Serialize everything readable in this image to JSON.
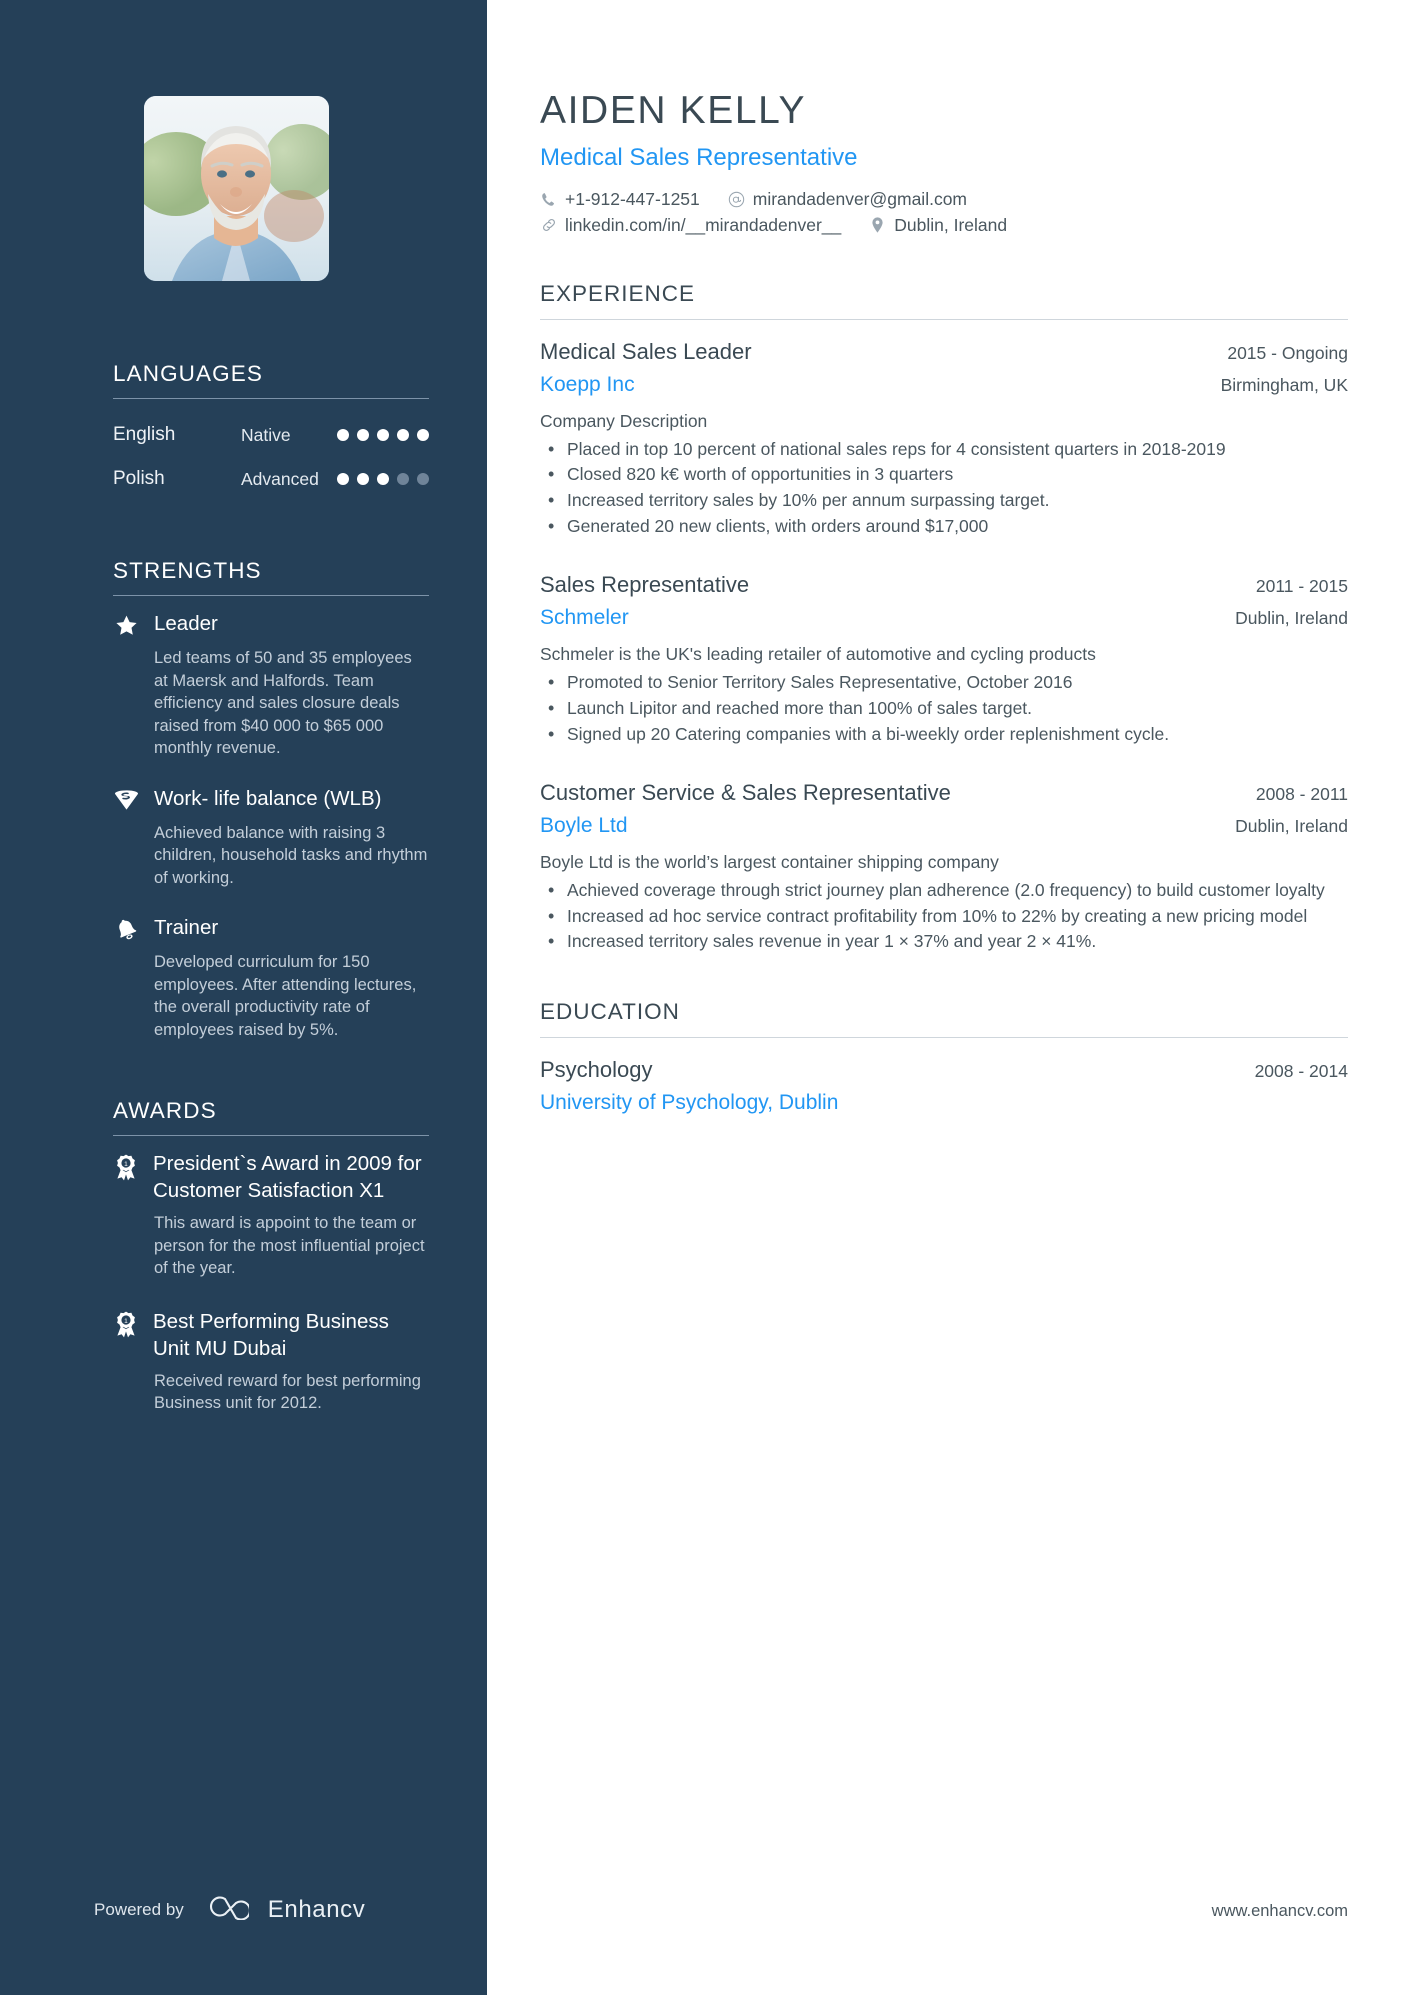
{
  "theme": {
    "sidebar_bg": "#254058",
    "accent": "#2196f3",
    "text_dark": "#3a4953",
    "text_body": "#4a575f"
  },
  "header": {
    "name": "AIDEN KELLY",
    "job_title": "Medical Sales Representative",
    "contacts": [
      {
        "icon": "phone-icon",
        "text": "+1-912-447-1251"
      },
      {
        "icon": "email-icon",
        "text": "mirandadenver@gmail.com"
      },
      {
        "icon": "link-icon",
        "text": "linkedin.com/in/__mirandadenver__"
      },
      {
        "icon": "location-pin-icon",
        "text": "Dublin, Ireland"
      }
    ]
  },
  "sidebar": {
    "photo_alt": "profile-photo",
    "languages": {
      "title": "LANGUAGES",
      "items": [
        {
          "name": "English",
          "level": "Native",
          "filled": 5,
          "total": 5
        },
        {
          "name": "Polish",
          "level": "Advanced",
          "filled": 3,
          "total": 5
        }
      ]
    },
    "strengths": {
      "title": "STRENGTHS",
      "items": [
        {
          "icon": "star-icon",
          "title": "Leader",
          "description": "Led teams of 50 and 35 employees at Maersk and Halfords. Team efficiency and sales closure deals raised from $40 000 to $65 000 monthly revenue."
        },
        {
          "icon": "shield-icon",
          "title": "Work- life balance (WLB)",
          "description": "Achieved balance with raising 3 children, household tasks and rhythm of working."
        },
        {
          "icon": "bell-icon",
          "title": "Trainer",
          "description": "Developed curriculum for 150 employees. After attending lectures, the overall productivity rate of employees raised by 5%."
        }
      ]
    },
    "awards": {
      "title": "AWARDS",
      "items": [
        {
          "icon": "medal-icon",
          "title": "President`s Award in 2009 for Customer Satisfaction X1",
          "description": "This award is appoint to the team or person for the most influential project of the year."
        },
        {
          "icon": "medal-icon",
          "title": "Best Performing Business Unit MU Dubai",
          "description": "Received reward for best performing Business unit for 2012."
        }
      ]
    },
    "footer": {
      "powered_label": "Powered by",
      "brand": "Enhancv",
      "logo": "enhancv-logo-icon"
    }
  },
  "main": {
    "experience": {
      "title": "EXPERIENCE",
      "entries": [
        {
          "role": "Medical Sales Leader",
          "date": "2015 - Ongoing",
          "company": "Koepp Inc",
          "location": "Birmingham, UK",
          "description": "Company Description",
          "bullets": [
            "Placed in top 10 percent of national sales reps for 4 consistent quarters in 2018-2019",
            "Closed 820 k€ worth of opportunities in 3 quarters",
            "Increased territory sales by 10% per annum surpassing target.",
            "Generated 20 new clients, with orders around $17,000"
          ]
        },
        {
          "role": "Sales Representative",
          "date": "2011 - 2015",
          "company": "Schmeler",
          "location": "Dublin, Ireland",
          "description": "Schmeler is the UK's leading retailer of automotive and cycling products",
          "bullets": [
            "Promoted to Senior Territory Sales Representative, October 2016",
            "Launch Lipitor and reached more than 100% of sales target.",
            "Signed up 20 Catering companies with a bi-weekly order replenishment cycle."
          ]
        },
        {
          "role": "Customer Service & Sales Representative",
          "date": "2008 - 2011",
          "company": "Boyle Ltd",
          "location": "Dublin, Ireland",
          "description": "Boyle Ltd is the world’s largest container shipping company",
          "bullets": [
            "Achieved coverage through strict journey plan adherence (2.0 frequency) to build customer loyalty",
            "Increased ad hoc service contract profitability from 10% to 22% by creating a new pricing model",
            "Increased territory sales revenue in year 1 × 37% and year 2 × 41%."
          ]
        }
      ]
    },
    "education": {
      "title": "EDUCATION",
      "entries": [
        {
          "degree": "Psychology",
          "date": "2008 - 2014",
          "school": "University of Psychology, Dublin"
        }
      ]
    },
    "site_url": "www.enhancv.com"
  }
}
